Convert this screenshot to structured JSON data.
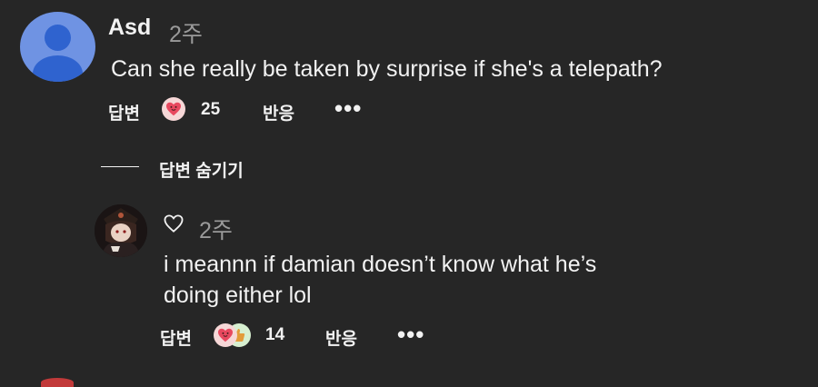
{
  "comment1": {
    "username": "Asd",
    "time": "2주",
    "text": "Can she really be taken by surprise if she's a telepath?",
    "reply_label": "답변",
    "reaction_count": "25",
    "react_label": "반응",
    "more_label": "•••"
  },
  "replies_toggle": {
    "label": "답변 숨기기"
  },
  "reply1": {
    "time": "2주",
    "text_line1": "i meannn if damian doesn’t know what he’s",
    "text_line2": "doing either lol",
    "reply_label": "답변",
    "reaction_count": "14",
    "react_label": "반응",
    "more_label": "•••"
  },
  "colors": {
    "background": "#262626",
    "text": "#f2f2f2",
    "muted": "#9a9a9a",
    "avatar_blue": "#6f93e3",
    "heart": "#e8485f"
  }
}
